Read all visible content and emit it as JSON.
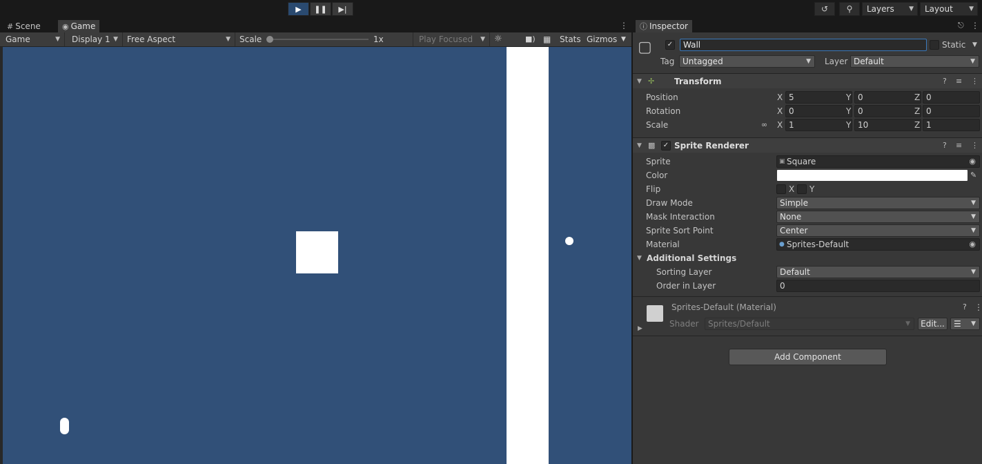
{
  "toolbar": {
    "play_icon": "play-icon",
    "pause_icon": "pause-icon",
    "step_icon": "step-icon",
    "history_icon": "history-icon",
    "search_icon": "search-icon",
    "layers_label": "Layers",
    "layout_label": "Layout"
  },
  "game_panel": {
    "tabs": [
      {
        "label": "Scene",
        "icon": "scene-grid-icon"
      },
      {
        "label": "Game",
        "icon": "gamepad-icon"
      }
    ],
    "bar": {
      "view_mode": "Game",
      "display": "Display 1",
      "aspect": "Free Aspect",
      "scale_label": "Scale",
      "scale_value": "1x",
      "play_focused": "Play Focused",
      "stats_label": "Stats",
      "gizmos_label": "Gizmos"
    },
    "viewport_color": "#315078"
  },
  "inspector": {
    "tab_label": "Inspector",
    "object": {
      "active": true,
      "name": "Wall",
      "static_label": "Static",
      "tag_label": "Tag",
      "tag_value": "Untagged",
      "layer_label": "Layer",
      "layer_value": "Default"
    },
    "transform": {
      "title": "Transform",
      "position": {
        "label": "Position",
        "x": "5",
        "y": "0",
        "z": "0"
      },
      "rotation": {
        "label": "Rotation",
        "x": "0",
        "y": "0",
        "z": "0"
      },
      "scale": {
        "label": "Scale",
        "x": "1",
        "y": "10",
        "z": "1"
      }
    },
    "sprite_renderer": {
      "title": "Sprite Renderer",
      "enabled": true,
      "sprite_label": "Sprite",
      "sprite_value": "Square",
      "color_label": "Color",
      "color_value": "#ffffff",
      "flip_label": "Flip",
      "flip_x_label": "X",
      "flip_y_label": "Y",
      "draw_mode_label": "Draw Mode",
      "draw_mode_value": "Simple",
      "mask_label": "Mask Interaction",
      "mask_value": "None",
      "sort_point_label": "Sprite Sort Point",
      "sort_point_value": "Center",
      "material_label": "Material",
      "material_value": "Sprites-Default",
      "additional_label": "Additional Settings",
      "sorting_layer_label": "Sorting Layer",
      "sorting_layer_value": "Default",
      "order_label": "Order in Layer",
      "order_value": "0"
    },
    "material": {
      "title": "Sprites-Default (Material)",
      "shader_label": "Shader",
      "shader_value": "Sprites/Default",
      "edit_label": "Edit..."
    },
    "add_component_label": "Add Component"
  }
}
